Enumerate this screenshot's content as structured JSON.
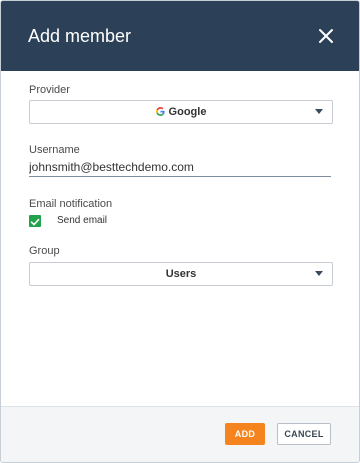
{
  "dialog": {
    "title": "Add member"
  },
  "provider": {
    "label": "Provider",
    "value": "Google"
  },
  "username": {
    "label": "Username",
    "value": "johnsmith@besttechdemo.com"
  },
  "email_notification": {
    "label": "Email notification",
    "checkbox_label": "Send email",
    "checked": true
  },
  "group": {
    "label": "Group",
    "value": "Users"
  },
  "footer": {
    "add_label": "ADD",
    "cancel_label": "CANCEL"
  },
  "colors": {
    "header": "#2c4057",
    "accent": "#f5841f",
    "checkbox": "#23a24d"
  }
}
